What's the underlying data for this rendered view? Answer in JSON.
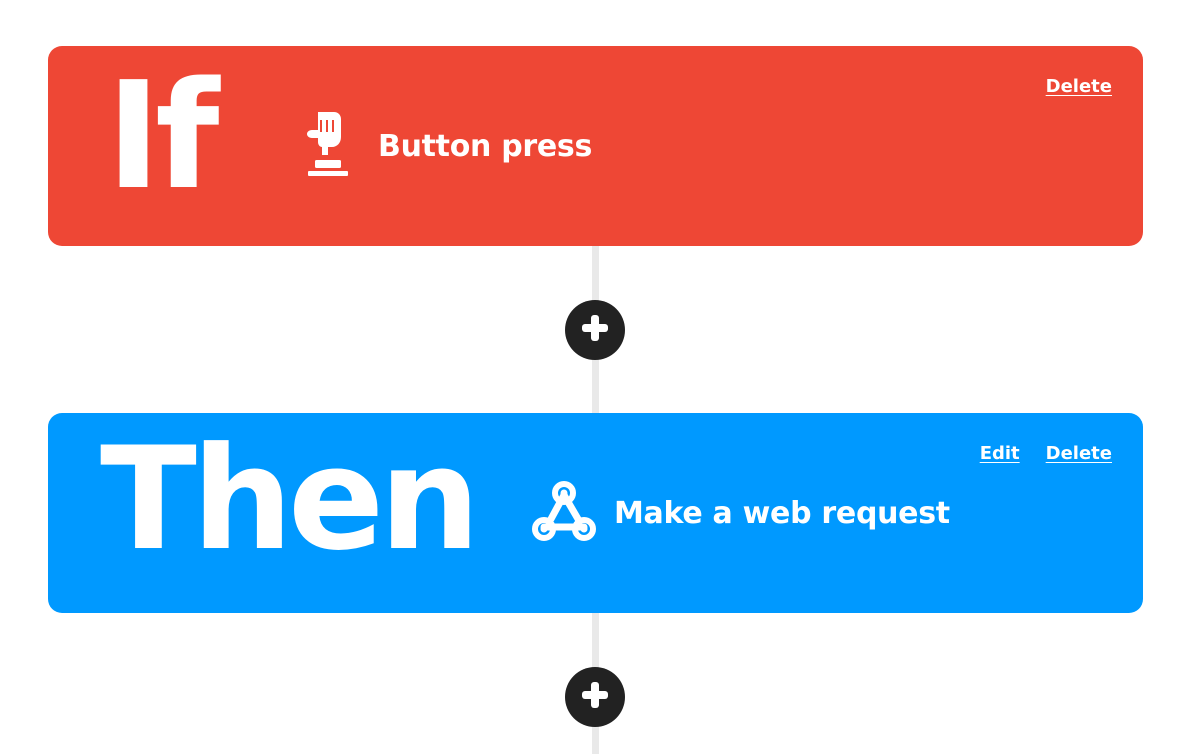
{
  "colors": {
    "if_background": "#ee4735",
    "then_background": "#0099ff",
    "add_button": "#222222",
    "connector": "#e9e9e9"
  },
  "trigger": {
    "keyword": "If",
    "service_label": "Button press",
    "icon": "button-press-icon",
    "actions": {
      "delete_label": "Delete"
    }
  },
  "action": {
    "keyword": "Then",
    "service_label": "Make a web request",
    "icon": "webhooks-icon",
    "actions": {
      "edit_label": "Edit",
      "delete_label": "Delete"
    }
  },
  "add_buttons": [
    {
      "icon": "plus-icon"
    },
    {
      "icon": "plus-icon"
    }
  ]
}
